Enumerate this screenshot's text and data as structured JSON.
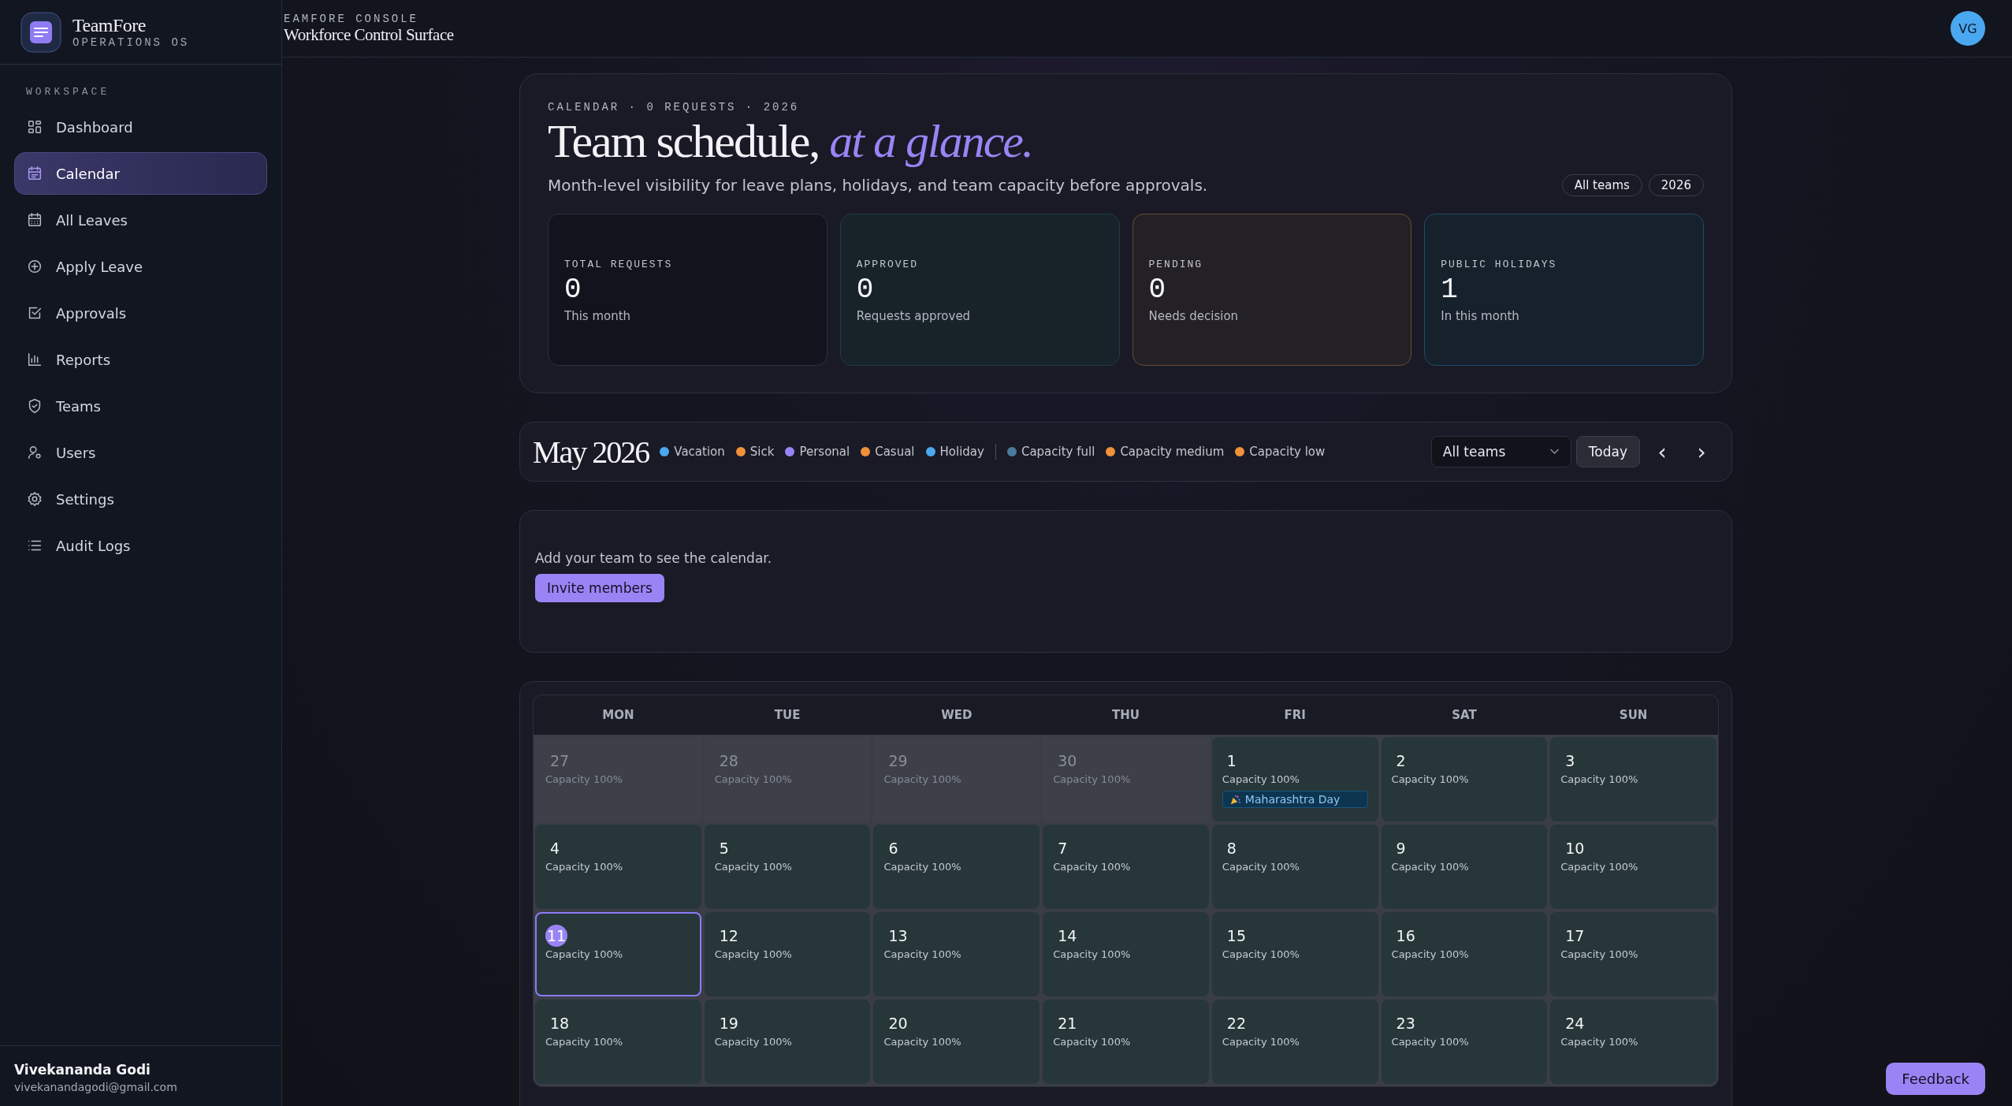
{
  "brand": {
    "name": "TeamFore",
    "tagline": "OPERATIONS OS"
  },
  "sidebar": {
    "section": "WORKSPACE",
    "items": [
      {
        "label": "Dashboard",
        "kind": "grid",
        "selected": false
      },
      {
        "label": "Calendar",
        "kind": "calendar",
        "selected": true
      },
      {
        "label": "All Leaves",
        "kind": "calendar-dots",
        "selected": false
      },
      {
        "label": "Apply Leave",
        "kind": "plus-circle",
        "selected": false
      },
      {
        "label": "Approvals",
        "kind": "check-square",
        "selected": false
      },
      {
        "label": "Reports",
        "kind": "bars",
        "selected": false
      },
      {
        "label": "Teams",
        "kind": "shield",
        "selected": false
      },
      {
        "label": "Users",
        "kind": "user-gear",
        "selected": false
      },
      {
        "label": "Settings",
        "kind": "gear",
        "selected": false
      },
      {
        "label": "Audit Logs",
        "kind": "list",
        "selected": false
      }
    ],
    "user": {
      "name": "Vivekananda Godi",
      "email": "vivekanandagodi@gmail.com"
    }
  },
  "topbar": {
    "eyebrow": "EAMFORE CONSOLE",
    "title": "Workforce Control Surface",
    "avatar": "VG"
  },
  "hero": {
    "eyebrow": "CALENDAR · 0 REQUESTS · 2026",
    "title": "Team schedule,",
    "title_accent": "at a glance.",
    "subtitle": "Month-level visibility for leave plans, holidays, and team capacity before approvals.",
    "chips": [
      "All teams",
      "2026"
    ],
    "stats": [
      {
        "kind": "total",
        "label": "TOTAL REQUESTS",
        "value": "0",
        "note": "This month"
      },
      {
        "kind": "approved",
        "label": "APPROVED",
        "value": "0",
        "note": "Requests approved"
      },
      {
        "kind": "pending",
        "label": "PENDING",
        "value": "0",
        "note": "Needs decision"
      },
      {
        "kind": "holidays",
        "label": "PUBLIC HOLIDAYS",
        "value": "1",
        "note": "In this month"
      }
    ]
  },
  "toolbar": {
    "month": "May 2026",
    "leave_types": [
      {
        "label": "Vacation",
        "color": "#4aa8f0"
      },
      {
        "label": "Sick",
        "color": "#f0913a"
      },
      {
        "label": "Personal",
        "color": "#9a84f5"
      },
      {
        "label": "Casual",
        "color": "#f0913a"
      },
      {
        "label": "Holiday",
        "color": "#4aa8f0"
      }
    ],
    "capacity_levels": [
      {
        "label": "Capacity full",
        "color": "#4a7a9c"
      },
      {
        "label": "Capacity medium",
        "color": "#f0913a"
      },
      {
        "label": "Capacity low",
        "color": "#f0913a"
      }
    ],
    "team_select": "All teams",
    "today_button": "Today",
    "prev": "‹",
    "next": "›"
  },
  "empty_state": {
    "message": "Add your team to see the calendar.",
    "button": "Invite members"
  },
  "calendar": {
    "weekdays": [
      "MON",
      "TUE",
      "WED",
      "THU",
      "FRI",
      "SAT",
      "SUN"
    ],
    "weeks": [
      [
        {
          "day": "27",
          "capacity": "Capacity 100%",
          "outside": true,
          "today": false
        },
        {
          "day": "28",
          "capacity": "Capacity 100%",
          "outside": true,
          "today": false
        },
        {
          "day": "29",
          "capacity": "Capacity 100%",
          "outside": true,
          "today": false
        },
        {
          "day": "30",
          "capacity": "Capacity 100%",
          "outside": true,
          "today": false
        },
        {
          "day": "1",
          "capacity": "Capacity 100%",
          "outside": false,
          "today": false,
          "holiday": "Maharashtra Day"
        },
        {
          "day": "2",
          "capacity": "Capacity 100%",
          "outside": false,
          "today": false
        },
        {
          "day": "3",
          "capacity": "Capacity 100%",
          "outside": false,
          "today": false
        }
      ],
      [
        {
          "day": "4",
          "capacity": "Capacity 100%",
          "outside": false,
          "today": false
        },
        {
          "day": "5",
          "capacity": "Capacity 100%",
          "outside": false,
          "today": false
        },
        {
          "day": "6",
          "capacity": "Capacity 100%",
          "outside": false,
          "today": false
        },
        {
          "day": "7",
          "capacity": "Capacity 100%",
          "outside": false,
          "today": false
        },
        {
          "day": "8",
          "capacity": "Capacity 100%",
          "outside": false,
          "today": false
        },
        {
          "day": "9",
          "capacity": "Capacity 100%",
          "outside": false,
          "today": false
        },
        {
          "day": "10",
          "capacity": "Capacity 100%",
          "outside": false,
          "today": false
        }
      ],
      [
        {
          "day": "11",
          "capacity": "Capacity 100%",
          "outside": false,
          "today": true
        },
        {
          "day": "12",
          "capacity": "Capacity 100%",
          "outside": false,
          "today": false
        },
        {
          "day": "13",
          "capacity": "Capacity 100%",
          "outside": false,
          "today": false
        },
        {
          "day": "14",
          "capacity": "Capacity 100%",
          "outside": false,
          "today": false
        },
        {
          "day": "15",
          "capacity": "Capacity 100%",
          "outside": false,
          "today": false
        },
        {
          "day": "16",
          "capacity": "Capacity 100%",
          "outside": false,
          "today": false
        },
        {
          "day": "17",
          "capacity": "Capacity 100%",
          "outside": false,
          "today": false
        }
      ],
      [
        {
          "day": "18",
          "capacity": "Capacity 100%",
          "outside": false,
          "today": false
        },
        {
          "day": "19",
          "capacity": "Capacity 100%",
          "outside": false,
          "today": false
        },
        {
          "day": "20",
          "capacity": "Capacity 100%",
          "outside": false,
          "today": false
        },
        {
          "day": "21",
          "capacity": "Capacity 100%",
          "outside": false,
          "today": false
        },
        {
          "day": "22",
          "capacity": "Capacity 100%",
          "outside": false,
          "today": false
        },
        {
          "day": "23",
          "capacity": "Capacity 100%",
          "outside": false,
          "today": false
        },
        {
          "day": "24",
          "capacity": "Capacity 100%",
          "outside": false,
          "today": false
        }
      ]
    ]
  },
  "feedback": "Feedback"
}
